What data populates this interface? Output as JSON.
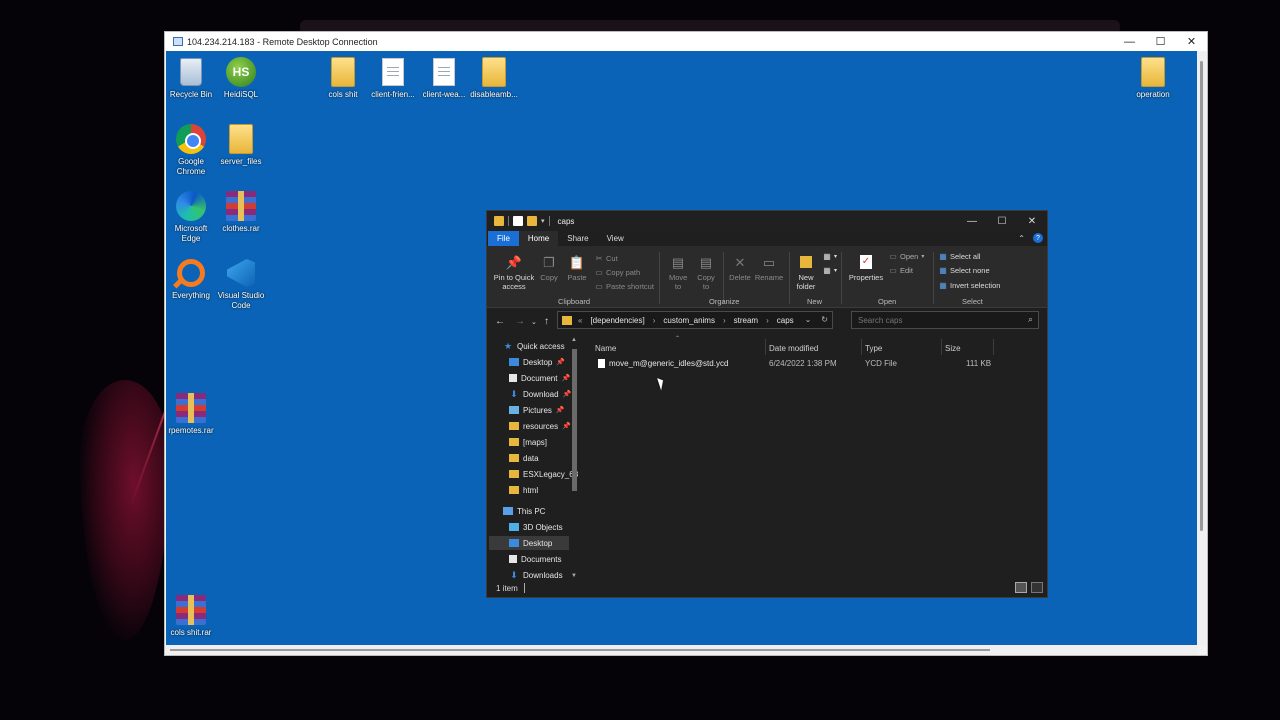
{
  "rdp": {
    "title": "104.234.214.183 - Remote Desktop Connection",
    "controls": [
      "—",
      "☐",
      "✕"
    ]
  },
  "desktop": {
    "icons": [
      {
        "label": "Recycle Bin",
        "icon": "recycle-bin-icon"
      },
      {
        "label": "HeidiSQL",
        "icon": "heidisql-icon",
        "badge": "HS"
      },
      {
        "label": "cols shit",
        "icon": "folder-icon"
      },
      {
        "label": "client-frien...",
        "icon": "document-icon"
      },
      {
        "label": "client-wea...",
        "icon": "document-icon"
      },
      {
        "label": "disableamb...",
        "icon": "folder-icon"
      },
      {
        "label": "operation",
        "icon": "folder-icon"
      },
      {
        "label": "Google Chrome",
        "icon": "chrome-icon"
      },
      {
        "label": "server_files",
        "icon": "folder-icon"
      },
      {
        "label": "Microsoft Edge",
        "icon": "edge-icon"
      },
      {
        "label": "clothes.rar",
        "icon": "winrar-archive-icon"
      },
      {
        "label": "Everything",
        "icon": "everything-search-icon"
      },
      {
        "label": "Visual Studio Code",
        "icon": "vscode-icon"
      },
      {
        "label": "rpemotes.rar",
        "icon": "winrar-archive-icon"
      },
      {
        "label": "cols shit.rar",
        "icon": "winrar-archive-icon"
      }
    ]
  },
  "explorer": {
    "title": "caps",
    "controls": [
      "—",
      "☐",
      "✕"
    ],
    "tabs": [
      "File",
      "Home",
      "Share",
      "View"
    ],
    "active_tab": "Home",
    "ribbon": {
      "pin_to_quick_access": "Pin to Quick access",
      "copy": "Copy",
      "paste": "Paste",
      "cut": "Cut",
      "copy_path": "Copy path",
      "paste_shortcut": "Paste shortcut",
      "clipboard_group": "Clipboard",
      "move_to": "Move to",
      "copy_to": "Copy to",
      "delete": "Delete",
      "rename": "Rename",
      "organize_group": "Organize",
      "new_folder": "New folder",
      "new_group": "New",
      "properties": "Properties",
      "open": "Open",
      "edit": "Edit",
      "open_group": "Open",
      "select_all": "Select all",
      "select_none": "Select none",
      "invert_selection": "Invert selection",
      "select_group": "Select"
    },
    "address": {
      "prefix": "«",
      "crumbs": [
        "[dependencies]",
        "custom_anims",
        "stream",
        "caps"
      ],
      "separator": "›"
    },
    "search": {
      "placeholder": "Search caps"
    },
    "nav_pane": {
      "quick_access": "Quick access",
      "items": [
        "Desktop",
        "Document",
        "Download",
        "Pictures",
        "resources",
        "[maps]",
        "data",
        "ESXLegacy_68",
        "html"
      ],
      "this_pc": "This PC",
      "pc_items": [
        "3D Objects",
        "Desktop",
        "Documents",
        "Downloads"
      ]
    },
    "columns": [
      "Name",
      "Date modified",
      "Type",
      "Size"
    ],
    "files": [
      {
        "name": "move_m@generic_idles@std.ycd",
        "date": "6/24/2022 1:38 PM",
        "type": "YCD File",
        "size": "111 KB"
      }
    ],
    "status": "1 item"
  }
}
